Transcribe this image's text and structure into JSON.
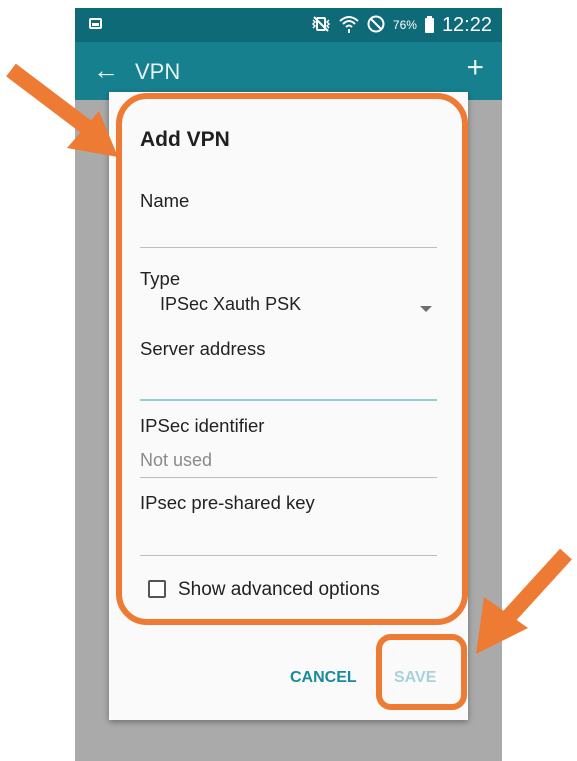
{
  "status_bar": {
    "icons": [
      "screenshot-icon",
      "mute-vibrate-icon",
      "wifi-icon",
      "block-icon",
      "battery-icon"
    ],
    "battery_percent": "76%",
    "time": "12:22"
  },
  "app_bar": {
    "title": "VPN",
    "back_icon": "arrow-left-icon",
    "add_icon": "plus-icon"
  },
  "dialog": {
    "title": "Add VPN",
    "name": {
      "label": "Name",
      "value": ""
    },
    "type": {
      "label": "Type",
      "value": "IPSec Xauth PSK"
    },
    "server_address": {
      "label": "Server address",
      "value": ""
    },
    "ipsec_identifier": {
      "label": "IPSec identifier",
      "value": "Not used"
    },
    "ipsec_psk": {
      "label": "IPsec pre-shared key",
      "value": ""
    },
    "show_advanced": {
      "label": "Show advanced options",
      "checked": false
    },
    "buttons": {
      "cancel": "CANCEL",
      "save": "SAVE"
    }
  },
  "colors": {
    "status_bar": "#0e6a77",
    "app_bar": "#17808f",
    "accent": "#188a9a",
    "disabled_accent": "#a6d3d8",
    "annotation": "#ee7b33"
  }
}
